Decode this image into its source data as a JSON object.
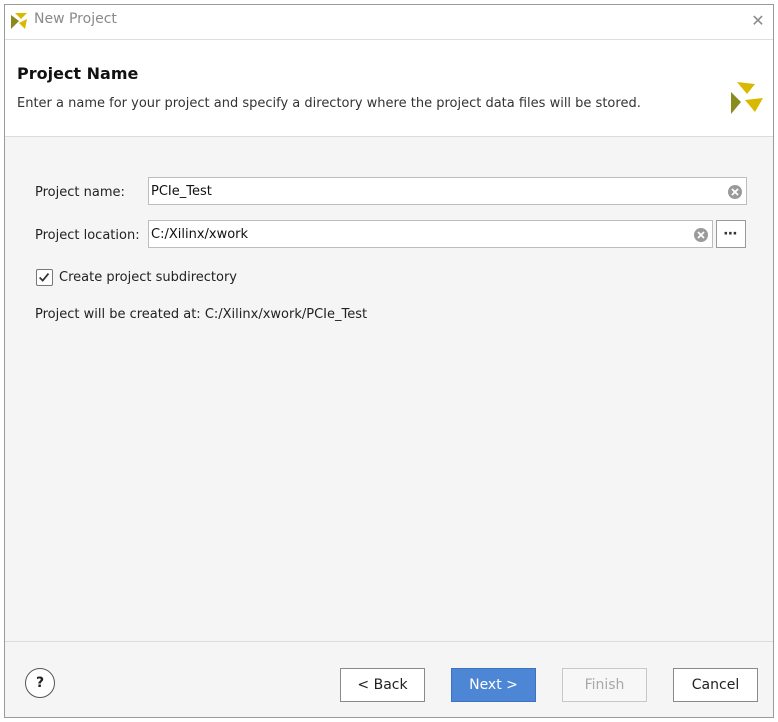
{
  "window": {
    "title": "New Project"
  },
  "header": {
    "heading": "Project Name",
    "description": "Enter a name for your project and specify a directory where the project data files will be stored."
  },
  "form": {
    "name_label": "Project name:",
    "name_value": "PCIe_Test",
    "location_label": "Project location:",
    "location_value": "C:/Xilinx/xwork",
    "browse_label": "⋯",
    "subdir_checkbox_checked": true,
    "subdir_label": "Create project subdirectory",
    "created_at_text": "Project will be created at: C:/Xilinx/xwork/PCIe_Test"
  },
  "footer": {
    "help_label": "?",
    "back_label": "< Back",
    "next_label": "Next >",
    "finish_label": "Finish",
    "cancel_label": "Cancel"
  },
  "colors": {
    "primary_button": "#4e86d6",
    "logo_yellow": "#d9b900",
    "logo_olive": "#8a8a1e"
  }
}
